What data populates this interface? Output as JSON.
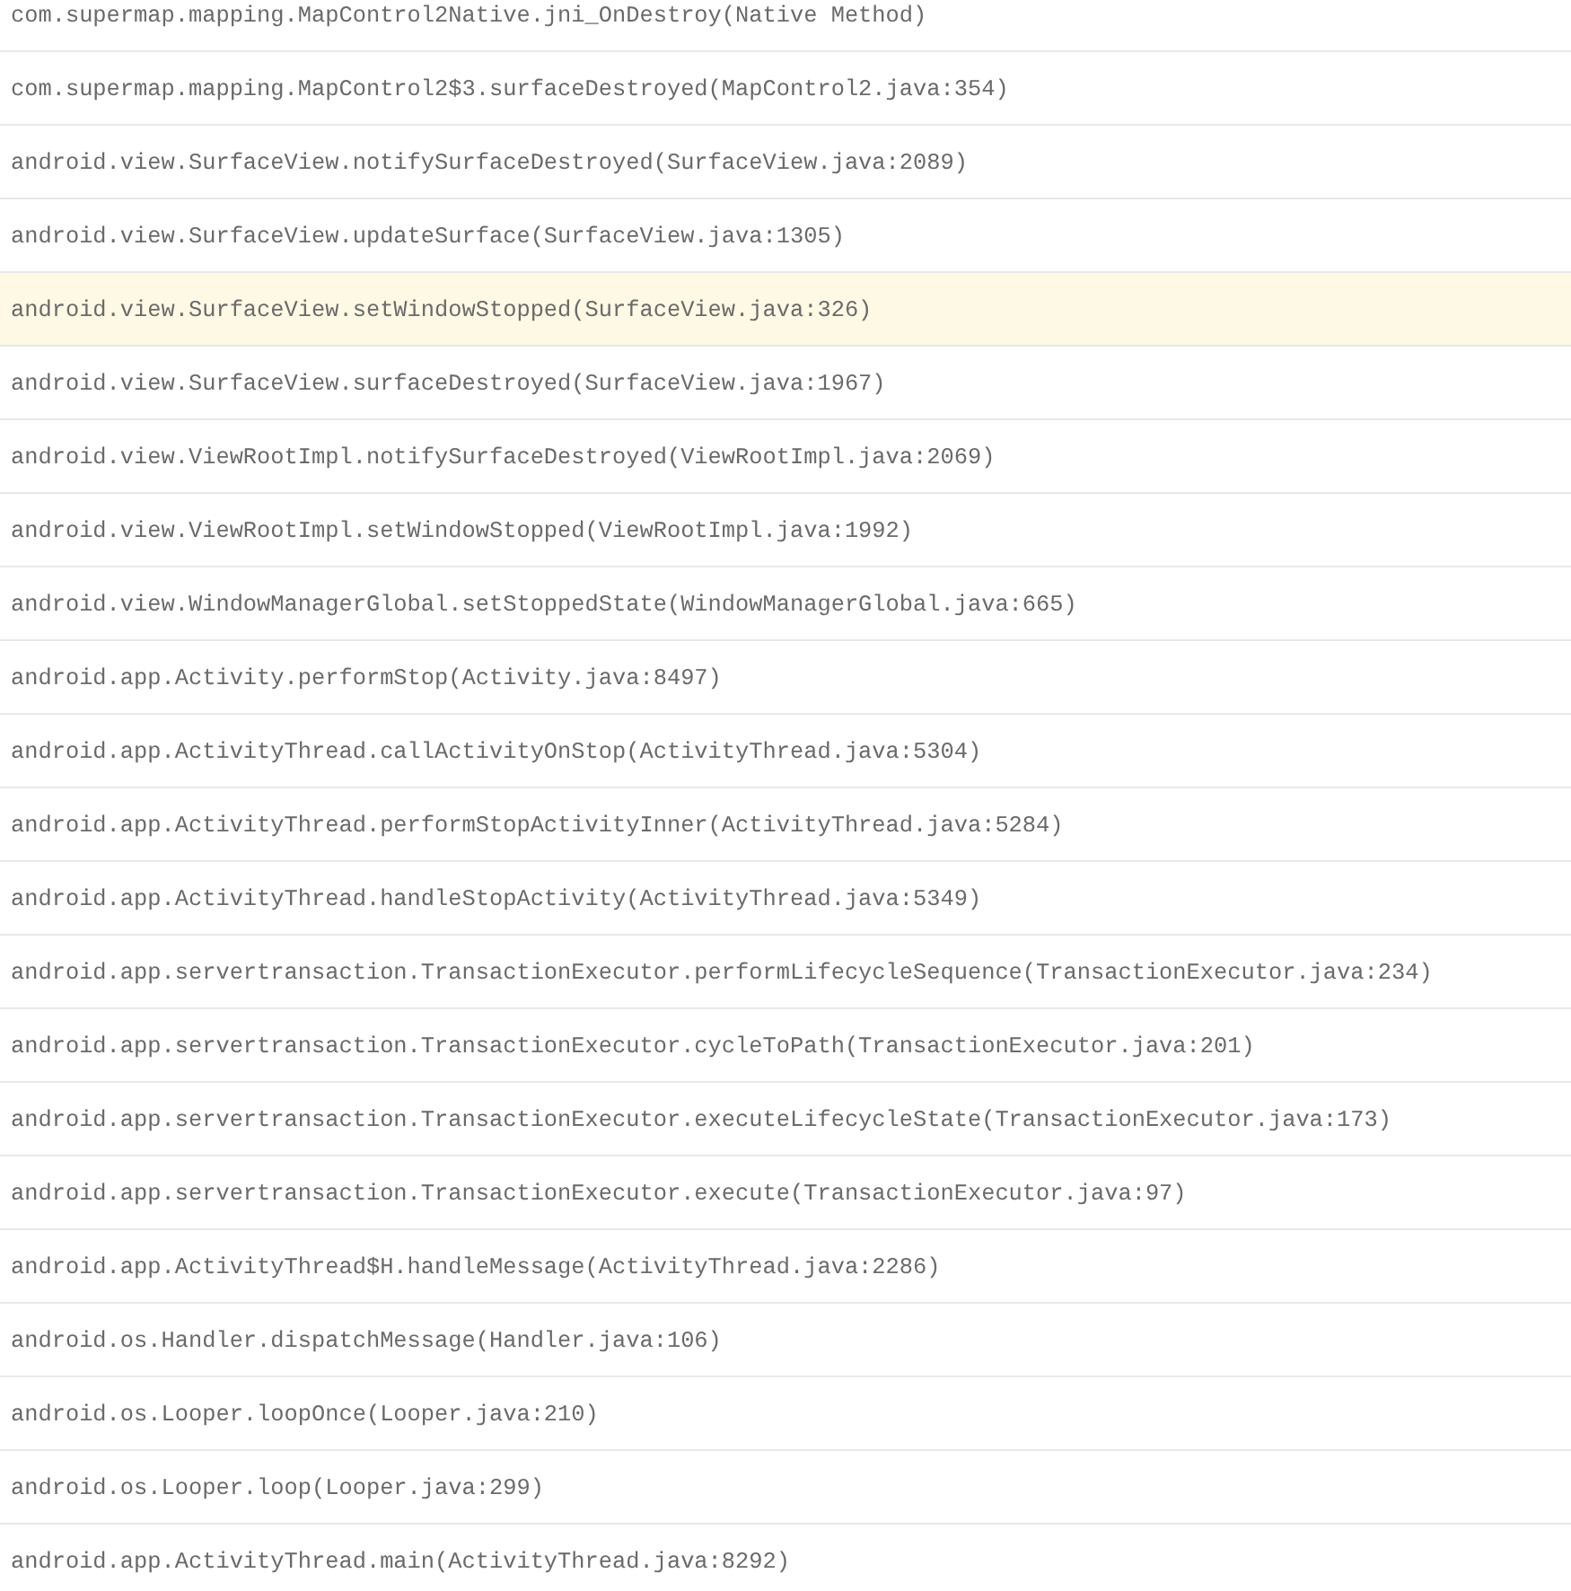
{
  "stack_frames": [
    {
      "text": "com.supermap.mapping.MapControl2Native.jni_OnDestroy(Native Method)",
      "selected": false
    },
    {
      "text": "com.supermap.mapping.MapControl2$3.surfaceDestroyed(MapControl2.java:354)",
      "selected": false
    },
    {
      "text": "android.view.SurfaceView.notifySurfaceDestroyed(SurfaceView.java:2089)",
      "selected": false
    },
    {
      "text": "android.view.SurfaceView.updateSurface(SurfaceView.java:1305)",
      "selected": false
    },
    {
      "text": "android.view.SurfaceView.setWindowStopped(SurfaceView.java:326)",
      "selected": true
    },
    {
      "text": "android.view.SurfaceView.surfaceDestroyed(SurfaceView.java:1967)",
      "selected": false
    },
    {
      "text": "android.view.ViewRootImpl.notifySurfaceDestroyed(ViewRootImpl.java:2069)",
      "selected": false
    },
    {
      "text": "android.view.ViewRootImpl.setWindowStopped(ViewRootImpl.java:1992)",
      "selected": false
    },
    {
      "text": "android.view.WindowManagerGlobal.setStoppedState(WindowManagerGlobal.java:665)",
      "selected": false
    },
    {
      "text": "android.app.Activity.performStop(Activity.java:8497)",
      "selected": false
    },
    {
      "text": "android.app.ActivityThread.callActivityOnStop(ActivityThread.java:5304)",
      "selected": false
    },
    {
      "text": "android.app.ActivityThread.performStopActivityInner(ActivityThread.java:5284)",
      "selected": false
    },
    {
      "text": "android.app.ActivityThread.handleStopActivity(ActivityThread.java:5349)",
      "selected": false
    },
    {
      "text": "android.app.servertransaction.TransactionExecutor.performLifecycleSequence(TransactionExecutor.java:234)",
      "selected": false
    },
    {
      "text": "android.app.servertransaction.TransactionExecutor.cycleToPath(TransactionExecutor.java:201)",
      "selected": false
    },
    {
      "text": "android.app.servertransaction.TransactionExecutor.executeLifecycleState(TransactionExecutor.java:173)",
      "selected": false
    },
    {
      "text": "android.app.servertransaction.TransactionExecutor.execute(TransactionExecutor.java:97)",
      "selected": false
    },
    {
      "text": "android.app.ActivityThread$H.handleMessage(ActivityThread.java:2286)",
      "selected": false
    },
    {
      "text": "android.os.Handler.dispatchMessage(Handler.java:106)",
      "selected": false
    },
    {
      "text": "android.os.Looper.loopOnce(Looper.java:210)",
      "selected": false
    },
    {
      "text": "android.os.Looper.loop(Looper.java:299)",
      "selected": false
    },
    {
      "text": "android.app.ActivityThread.main(ActivityThread.java:8292)",
      "selected": false
    }
  ]
}
